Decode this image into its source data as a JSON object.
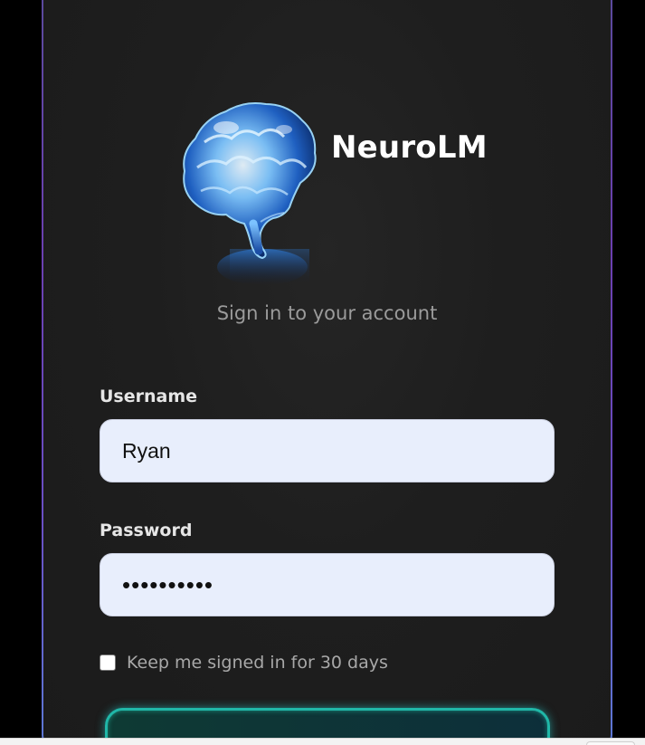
{
  "brand": {
    "name": "NeuroLM",
    "logo_icon": "brain-icon"
  },
  "subtitle": "Sign in to your account",
  "form": {
    "username": {
      "label": "Username",
      "value": "Ryan"
    },
    "password": {
      "label": "Password",
      "value": "••••••••••"
    },
    "remember": {
      "label": "Keep me signed in for 30 days",
      "checked": false
    }
  },
  "colors": {
    "card_background": "#1e1e1e",
    "input_background": "#e8eefc",
    "button_border": "#20b7a8",
    "frame_gradient": [
      "#5a4a9c",
      "#6b3fb0",
      "#5c7ad6"
    ]
  }
}
